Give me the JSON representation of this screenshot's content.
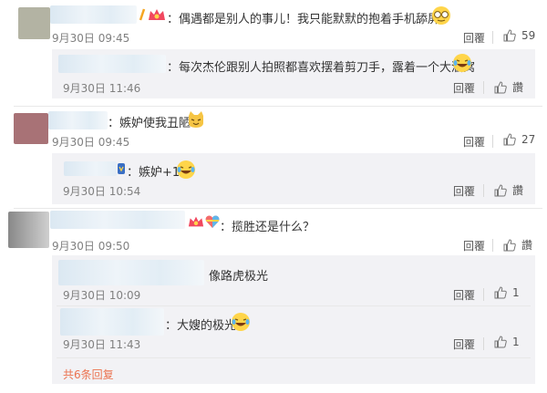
{
  "comments": [
    {
      "text": "：偶遇都是别人的事儿！我只能默默的抱着手机舔屏了",
      "time": "9月30日 09:45",
      "reply_label": "回覆",
      "likes": "59",
      "replies": [
        {
          "text": "：每次杰伦跟别人拍照都喜欢摆着剪刀手，露着一个大酒窝",
          "time": "9月30日 11:46",
          "reply_label": "回覆",
          "like_label": "讚"
        }
      ]
    },
    {
      "text": "：嫉妒使我丑陋",
      "time": "9月30日 09:45",
      "reply_label": "回覆",
      "likes": "27",
      "replies": [
        {
          "text": "：嫉妒+1",
          "time": "9月30日 10:54",
          "reply_label": "回覆",
          "like_label": "讚"
        }
      ]
    },
    {
      "text": "：揽胜还是什么？",
      "time": "9月30日 09:50",
      "reply_label": "回覆",
      "like_label": "讚",
      "replies": [
        {
          "text": "像路虎极光",
          "time": "9月30日 10:09",
          "reply_label": "回覆",
          "likes": "1"
        },
        {
          "text": "：大嫂的极光",
          "time": "9月30日 11:43",
          "reply_label": "回覆",
          "likes": "1"
        }
      ],
      "more_replies": "共6条回复"
    }
  ],
  "colors": {
    "reply_bg": "#f2f2f5",
    "link": "#eb7350",
    "muted": "#808080"
  },
  "icons": {
    "like": "thumbs-up-icon",
    "laugh": "laughing-tears-emoji",
    "glasses": "nerd-glasses-emoji",
    "cat": "cat-emoji",
    "heart": "heart-emoji",
    "badge": "vip-badge-icon"
  }
}
